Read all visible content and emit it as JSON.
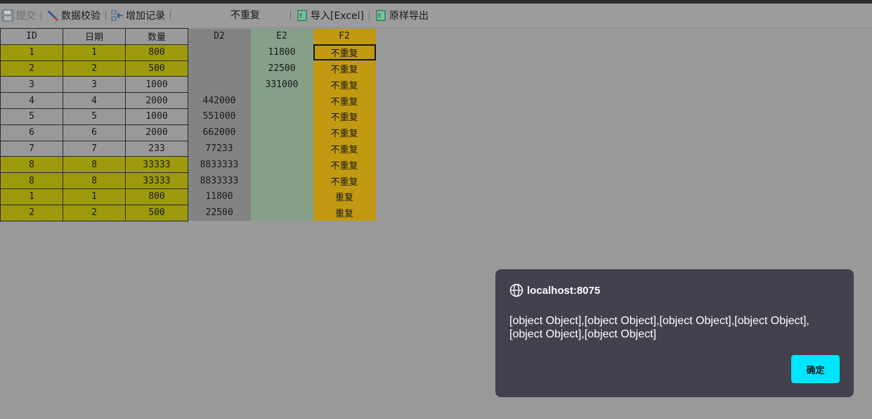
{
  "toolbar": {
    "submit": "提交",
    "validate": "数据校验",
    "add_record": "增加记录",
    "status": "不重复",
    "import_excel": "导入[Excel]",
    "export": "原样导出"
  },
  "grid": {
    "headers": [
      "ID",
      "日期",
      "数量",
      "D2",
      "E2",
      "F2"
    ],
    "rows": [
      {
        "highlight": true,
        "cells": [
          "1",
          "1",
          "800",
          "",
          "11800",
          "不重复"
        ]
      },
      {
        "highlight": true,
        "cells": [
          "2",
          "2",
          "500",
          "",
          "22500",
          "不重复"
        ]
      },
      {
        "highlight": false,
        "cells": [
          "3",
          "3",
          "1000",
          "",
          "331000",
          "不重复"
        ]
      },
      {
        "highlight": false,
        "cells": [
          "4",
          "4",
          "2000",
          "442000",
          "",
          "不重复"
        ]
      },
      {
        "highlight": false,
        "cells": [
          "5",
          "5",
          "1000",
          "551000",
          "",
          "不重复"
        ]
      },
      {
        "highlight": false,
        "cells": [
          "6",
          "6",
          "2000",
          "662000",
          "",
          "不重复"
        ]
      },
      {
        "highlight": false,
        "cells": [
          "7",
          "7",
          "233",
          "77233",
          "",
          "不重复"
        ]
      },
      {
        "highlight": true,
        "cells": [
          "8",
          "8",
          "33333",
          "8833333",
          "",
          "不重复"
        ]
      },
      {
        "highlight": true,
        "cells": [
          "8",
          "8",
          "33333",
          "8833333",
          "",
          "不重复"
        ]
      },
      {
        "highlight": true,
        "cells": [
          "1",
          "1",
          "800",
          "11800",
          "",
          "重复"
        ]
      },
      {
        "highlight": true,
        "cells": [
          "2",
          "2",
          "500",
          "22500",
          "",
          "重复"
        ]
      }
    ]
  },
  "dialog": {
    "origin": "localhost:8075",
    "message": "[object Object],[object Object],[object Object],[object Object],[object Object],[object Object]",
    "ok_label": "确定"
  },
  "colors": {
    "overlay": "#999999",
    "highlight_row": "#9e9a10",
    "col_d": "#838383",
    "col_e": "#86a08a",
    "col_f": "#c19a12",
    "dialog_bg": "#44414e",
    "ok_button": "#00e5ff"
  }
}
